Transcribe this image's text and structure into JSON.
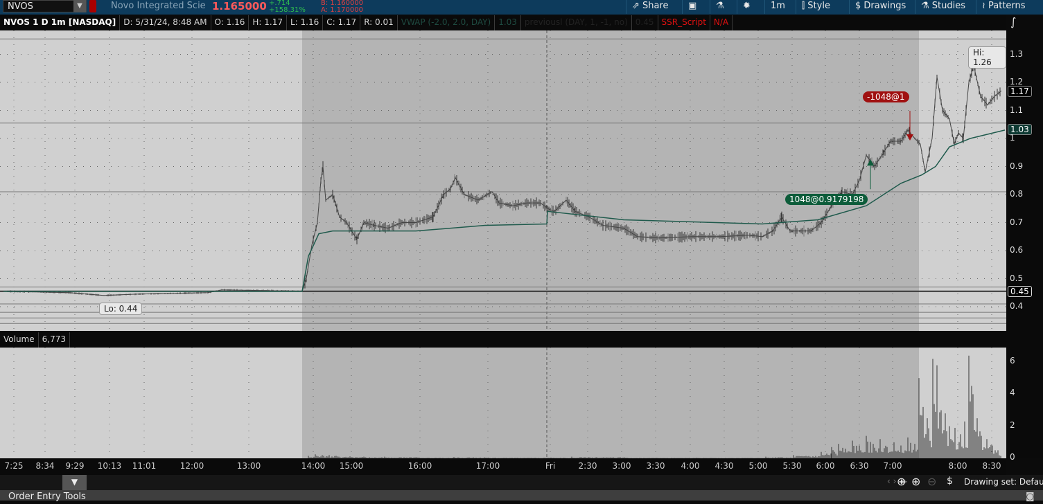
{
  "header": {
    "symbol": "NVOS",
    "company": "Novo Integrated Scie",
    "last": "1.165000",
    "change": "+.714",
    "change_pct": "+158.31%",
    "bid": "B: 1.160000",
    "ask": "A: 1.170000",
    "buttons": [
      {
        "label": "Share",
        "icon": "share-icon"
      },
      {
        "label": "",
        "icon": "notes-icon"
      },
      {
        "label": "",
        "icon": "flask-icon"
      },
      {
        "label": "",
        "icon": "gear-icon"
      },
      {
        "label": "1m",
        "icon": ""
      },
      {
        "label": "Style",
        "icon": "candle-icon"
      },
      {
        "label": "Drawings",
        "icon": "dollar-icon"
      },
      {
        "label": "Studies",
        "icon": "flask-icon"
      },
      {
        "label": "Patterns",
        "icon": "patterns-icon"
      }
    ]
  },
  "info": {
    "title": "NVOS 1 D 1m [NASDAQ]",
    "date": "D: 5/31/24, 8:48 AM",
    "open": "O: 1.16",
    "high": "H: 1.17",
    "low": "L: 1.16",
    "close": "C: 1.17",
    "range": "R: 0.01",
    "vwap_label": "VWAP (-2.0, 2.0, DAY)",
    "vwap_value": "1.03",
    "prev_label": "previousl (DAY, 1, -1, no)",
    "prev_value": "0.45",
    "ssr_label": "SSR_Script",
    "ssr_value": "N/A"
  },
  "annotations": {
    "hi": "Hi: 1.26",
    "lo": "Lo: 0.44",
    "buy": "1048@0.9179198",
    "sell": "-1048@1"
  },
  "price_tags": {
    "last": "1.17",
    "vwap": "1.03",
    "prev": "0.45"
  },
  "volume": {
    "label": "Volume",
    "value": "6,773"
  },
  "colors": {
    "bg_regular": "#d0d0d0",
    "bg_extended": "#b4b4b4",
    "vwap": "#1f5a4c",
    "buy": "#0d5c3a",
    "sell": "#a01010",
    "topbar": "#0d3b5c"
  },
  "bottom": {
    "drawing_set": "Drawing set: Default",
    "order_entry": "Order Entry Tools"
  },
  "chart_data": {
    "type": "line",
    "x_units": "bar index",
    "xlim": [
      0,
      1447
    ],
    "ylim": [
      0.32,
      1.38
    ],
    "y_ticks": [
      "1.3",
      "1.2",
      "1.1",
      "1",
      "0.9",
      "0.8",
      "0.7",
      "0.6",
      "0.5",
      "0.4"
    ],
    "x_ticks": [
      {
        "x": 15,
        "label": "7:25"
      },
      {
        "x": 60,
        "label": "8:34"
      },
      {
        "x": 103,
        "label": "9:29"
      },
      {
        "x": 153,
        "label": "10:13"
      },
      {
        "x": 203,
        "label": "11:01"
      },
      {
        "x": 272,
        "label": "12:00"
      },
      {
        "x": 354,
        "label": "13:00"
      },
      {
        "x": 447,
        "label": "14:00"
      },
      {
        "x": 502,
        "label": "15:00"
      },
      {
        "x": 601,
        "label": "16:00"
      },
      {
        "x": 699,
        "label": "17:00"
      },
      {
        "x": 789,
        "label": "Fri"
      },
      {
        "x": 843,
        "label": "2:30"
      },
      {
        "x": 892,
        "label": "3:00"
      },
      {
        "x": 941,
        "label": "3:30"
      },
      {
        "x": 991,
        "label": "4:00"
      },
      {
        "x": 1040,
        "label": "4:30"
      },
      {
        "x": 1089,
        "label": "5:00"
      },
      {
        "x": 1138,
        "label": "5:30"
      },
      {
        "x": 1186,
        "label": "6:00"
      },
      {
        "x": 1235,
        "label": "6:30"
      },
      {
        "x": 1283,
        "label": "7:00"
      },
      {
        "x": 1377,
        "label": "8:00"
      },
      {
        "x": 1426,
        "label": "8:30"
      }
    ],
    "extended_hours": [
      [
        431,
        1321
      ]
    ],
    "price": [
      [
        0,
        0.455
      ],
      [
        95,
        0.45
      ],
      [
        145,
        0.44
      ],
      [
        195,
        0.445
      ],
      [
        295,
        0.45
      ],
      [
        315,
        0.46
      ],
      [
        431,
        0.455
      ],
      [
        437,
        0.5
      ],
      [
        445,
        0.62
      ],
      [
        453,
        0.7
      ],
      [
        458,
        0.85
      ],
      [
        461,
        0.9
      ],
      [
        465,
        0.78
      ],
      [
        475,
        0.8
      ],
      [
        485,
        0.72
      ],
      [
        495,
        0.7
      ],
      [
        510,
        0.64
      ],
      [
        520,
        0.7
      ],
      [
        535,
        0.69
      ],
      [
        555,
        0.68
      ],
      [
        575,
        0.7
      ],
      [
        595,
        0.7
      ],
      [
        620,
        0.72
      ],
      [
        635,
        0.8
      ],
      [
        645,
        0.82
      ],
      [
        652,
        0.86
      ],
      [
        665,
        0.8
      ],
      [
        685,
        0.78
      ],
      [
        705,
        0.81
      ],
      [
        715,
        0.77
      ],
      [
        735,
        0.76
      ],
      [
        755,
        0.77
      ],
      [
        775,
        0.77
      ],
      [
        785,
        0.75
      ],
      [
        795,
        0.74
      ],
      [
        812,
        0.78
      ],
      [
        825,
        0.74
      ],
      [
        845,
        0.72
      ],
      [
        865,
        0.69
      ],
      [
        895,
        0.68
      ],
      [
        915,
        0.65
      ],
      [
        945,
        0.645
      ],
      [
        995,
        0.65
      ],
      [
        1035,
        0.65
      ],
      [
        1075,
        0.655
      ],
      [
        1095,
        0.65
      ],
      [
        1110,
        0.67
      ],
      [
        1123,
        0.72
      ],
      [
        1135,
        0.67
      ],
      [
        1165,
        0.67
      ],
      [
        1180,
        0.7
      ],
      [
        1195,
        0.76
      ],
      [
        1210,
        0.81
      ],
      [
        1225,
        0.8
      ],
      [
        1235,
        0.85
      ],
      [
        1245,
        0.94
      ],
      [
        1257,
        0.9
      ],
      [
        1270,
        0.95
      ],
      [
        1280,
        0.99
      ],
      [
        1295,
        0.99
      ],
      [
        1305,
        1.03
      ],
      [
        1315,
        1.0
      ],
      [
        1323,
        0.98
      ],
      [
        1330,
        0.88
      ],
      [
        1340,
        1.0
      ],
      [
        1347,
        1.22
      ],
      [
        1355,
        1.1
      ],
      [
        1365,
        1.07
      ],
      [
        1372,
        0.98
      ],
      [
        1378,
        1.02
      ],
      [
        1385,
        1.0
      ],
      [
        1393,
        1.2
      ],
      [
        1400,
        1.26
      ],
      [
        1410,
        1.15
      ],
      [
        1420,
        1.12
      ],
      [
        1430,
        1.15
      ],
      [
        1440,
        1.17
      ]
    ],
    "vwap": [
      [
        0,
        0.455
      ],
      [
        431,
        0.455
      ],
      [
        440,
        0.58
      ],
      [
        455,
        0.66
      ],
      [
        475,
        0.67
      ],
      [
        595,
        0.67
      ],
      [
        695,
        0.69
      ],
      [
        784,
        0.695
      ],
      [
        785,
        0.74
      ],
      [
        895,
        0.71
      ],
      [
        1095,
        0.695
      ],
      [
        1175,
        0.71
      ],
      [
        1245,
        0.76
      ],
      [
        1295,
        0.84
      ],
      [
        1325,
        0.87
      ],
      [
        1345,
        0.9
      ],
      [
        1365,
        0.97
      ],
      [
        1395,
        1.0
      ],
      [
        1445,
        1.03
      ]
    ],
    "hlines": [
      1.355,
      1.055,
      0.81,
      0.47,
      0.455,
      0.41,
      0.38,
      0.36,
      0.34
    ],
    "trades": [
      {
        "side": "buy",
        "x": 1251,
        "price": 0.9179198
      },
      {
        "side": "sell",
        "x": 1308,
        "price": 1.0
      }
    ],
    "volume_ylim": [
      0,
      7
    ],
    "volume_ticks": [
      "6",
      "4",
      "2",
      "0"
    ],
    "volume_bars": [
      [
        440,
        0.15
      ],
      [
        450,
        0.25
      ],
      [
        460,
        0.2
      ],
      [
        470,
        0.2
      ],
      [
        480,
        0.15
      ],
      [
        500,
        0.12
      ],
      [
        520,
        0.1
      ],
      [
        550,
        0.1
      ],
      [
        600,
        0.05
      ],
      [
        650,
        0.08
      ],
      [
        700,
        0.05
      ],
      [
        790,
        0.05
      ],
      [
        820,
        0.1
      ],
      [
        900,
        0.04
      ],
      [
        1000,
        0.04
      ],
      [
        1100,
        0.1
      ],
      [
        1140,
        0.2
      ],
      [
        1180,
        0.4
      ],
      [
        1195,
        0.7
      ],
      [
        1205,
        0.9
      ],
      [
        1215,
        0.6
      ],
      [
        1225,
        1.1
      ],
      [
        1235,
        0.8
      ],
      [
        1245,
        1.4
      ],
      [
        1255,
        0.9
      ],
      [
        1265,
        1.2
      ],
      [
        1275,
        0.7
      ],
      [
        1285,
        1.0
      ],
      [
        1295,
        0.8
      ],
      [
        1305,
        1.3
      ],
      [
        1315,
        0.9
      ],
      [
        1321,
        5.0
      ],
      [
        1327,
        3.2
      ],
      [
        1333,
        2.5
      ],
      [
        1341,
        6.2
      ],
      [
        1347,
        5.8
      ],
      [
        1353,
        3.0
      ],
      [
        1359,
        2.8
      ],
      [
        1365,
        2.0
      ],
      [
        1373,
        1.9
      ],
      [
        1381,
        1.5
      ],
      [
        1387,
        2.3
      ],
      [
        1393,
        6.4
      ],
      [
        1399,
        4.0
      ],
      [
        1405,
        2.5
      ],
      [
        1411,
        1.4
      ],
      [
        1419,
        1.2
      ],
      [
        1427,
        0.8
      ],
      [
        1435,
        0.5
      ]
    ]
  }
}
